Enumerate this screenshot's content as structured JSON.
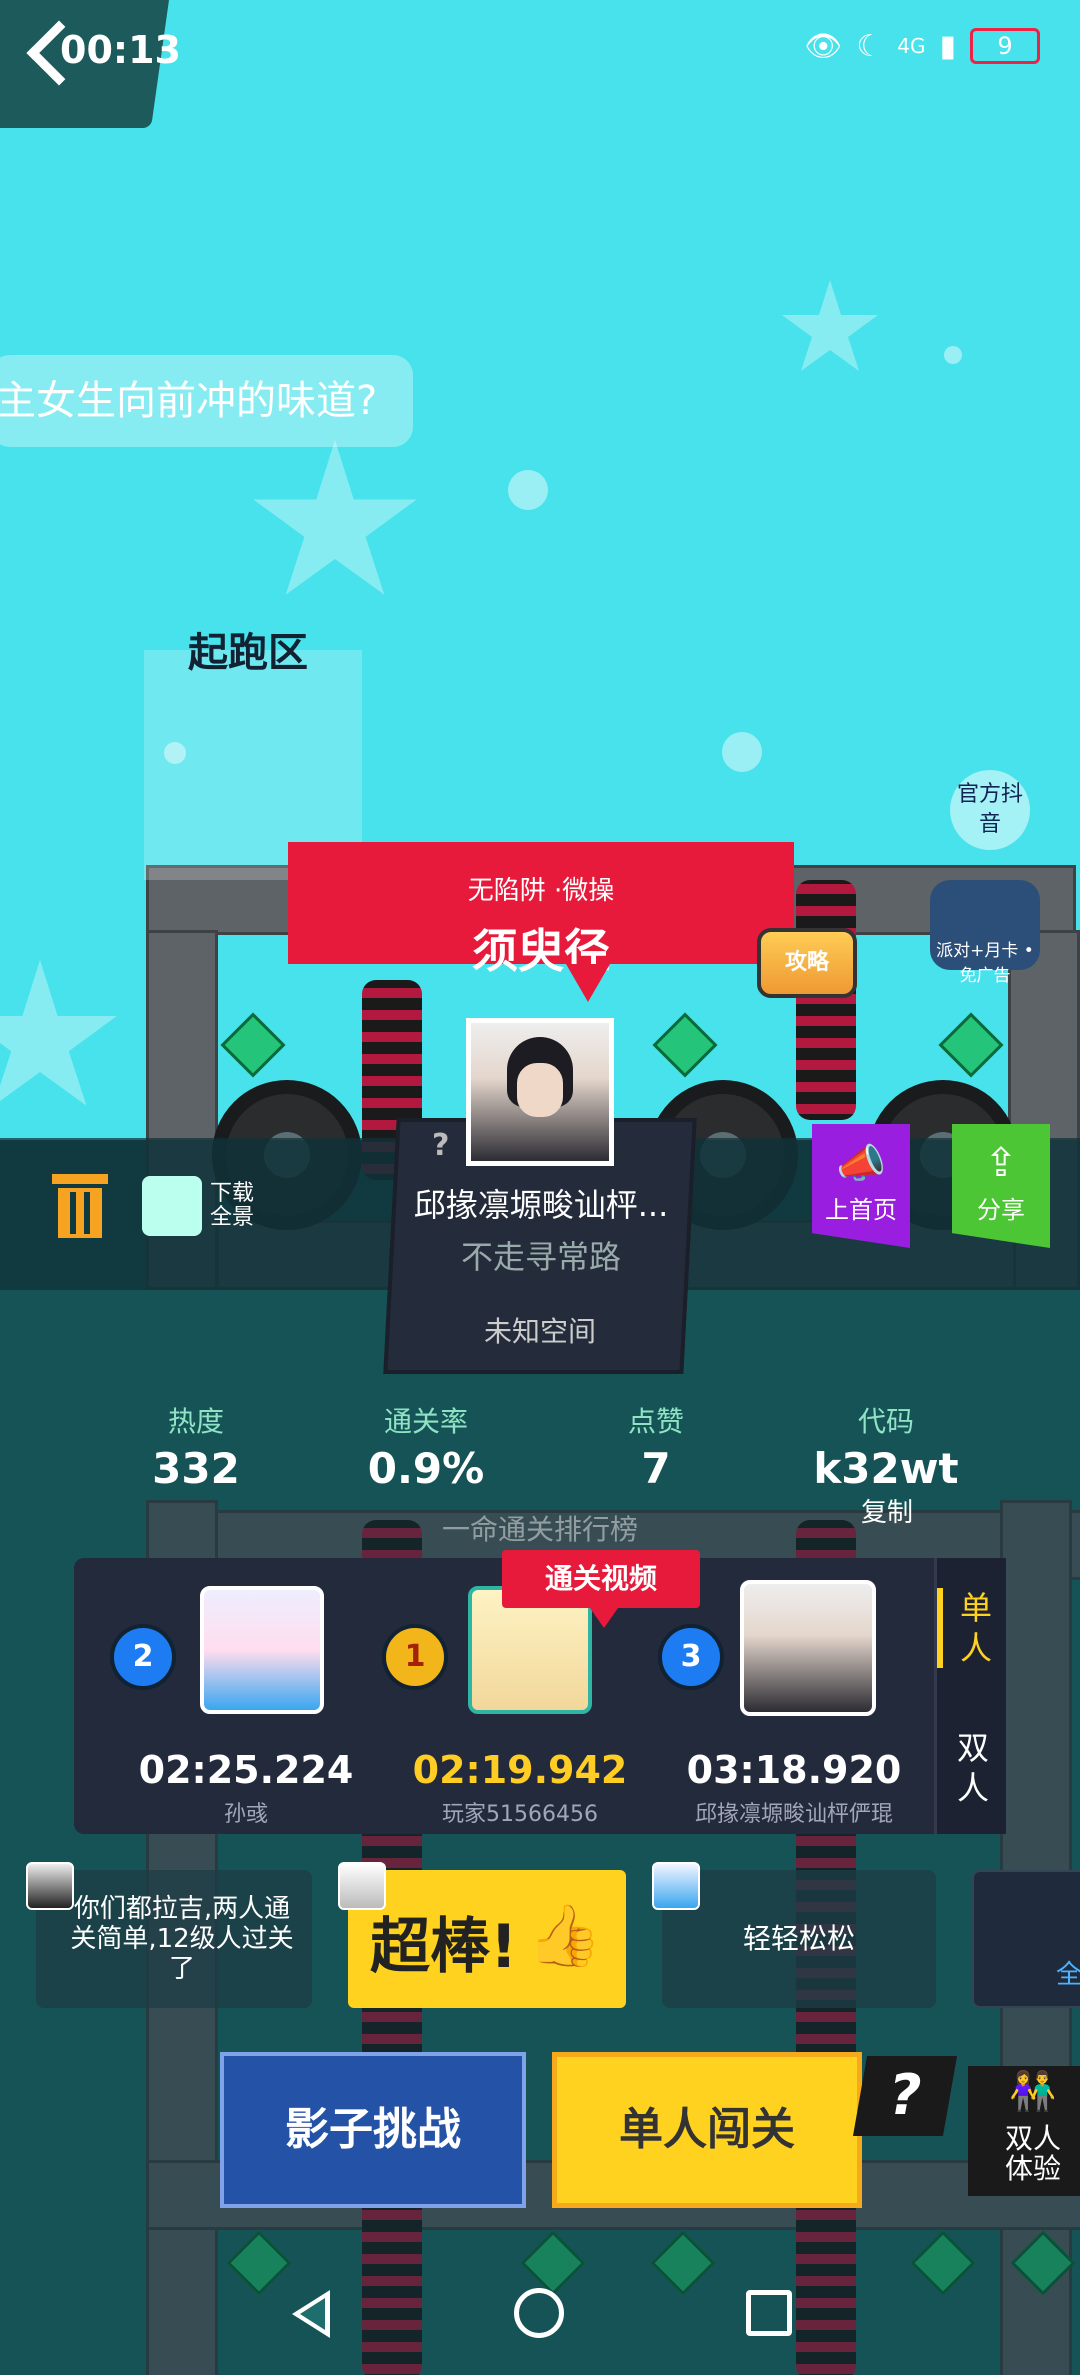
{
  "status_bar": {
    "time": "00:13",
    "network": "4G",
    "battery": "9"
  },
  "chat": {
    "text": "主女生向前冲的味道?"
  },
  "level": {
    "start_zone_label": "起跑区",
    "tags": "无陷阱 ·微操",
    "name": "须臾径",
    "guide_label": "攻略",
    "official_label": "官方抖音",
    "gift_label": "派对+月卡 •免广告"
  },
  "toolbar": {
    "download_label": "下载全景",
    "homepage_label": "上首页",
    "share_label": "分享"
  },
  "author": {
    "unknown_mark": "?",
    "name": "邱掾凛塬畯讪枰...",
    "motto": "不走寻常路",
    "space": "未知空间"
  },
  "stats": [
    {
      "label": "热度",
      "value": "332"
    },
    {
      "label": "通关率",
      "value": "0.9%"
    },
    {
      "label": "点赞",
      "value": "7"
    },
    {
      "label": "代码",
      "value": "k32wt"
    }
  ],
  "copy_label": "复制",
  "leaderboard": {
    "title": "一命通关排行榜",
    "video_tag": "通关视频",
    "tabs": [
      "单人",
      "双人"
    ],
    "entries": [
      {
        "rank": "2",
        "time": "02:25.224",
        "player": "孙彧"
      },
      {
        "rank": "1",
        "time": "02:19.942",
        "player": "玩家51566456"
      },
      {
        "rank": "3",
        "time": "03:18.920",
        "player": "邱掾凛塬畯讪枰俨琨"
      }
    ]
  },
  "comments": [
    {
      "text": "你们都拉吉,两人通关简单,12级人过关了"
    },
    {
      "text": "超棒!"
    },
    {
      "text": "轻轻松松"
    },
    {
      "text": "全"
    }
  ],
  "buttons": {
    "shadow": "影子挑战",
    "single": "单人闯关",
    "help": "?",
    "duo": "双人体验"
  },
  "colors": {
    "accent_red": "#e81a3b",
    "accent_yellow": "#ffd21f",
    "sky": "#48e2ec"
  }
}
